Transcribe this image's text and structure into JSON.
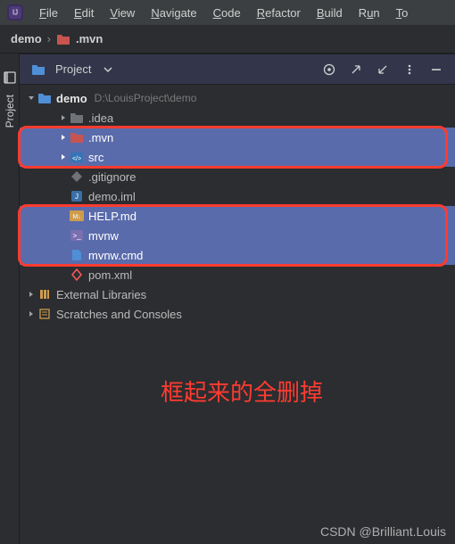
{
  "menubar": {
    "items": [
      {
        "u": "F",
        "rest": "ile"
      },
      {
        "u": "E",
        "rest": "dit"
      },
      {
        "u": "V",
        "rest": "iew"
      },
      {
        "u": "N",
        "rest": "avigate"
      },
      {
        "u": "C",
        "rest": "ode"
      },
      {
        "u": "R",
        "rest": "efactor"
      },
      {
        "u": "B",
        "rest": "uild"
      },
      {
        "u": "R",
        "post": "u",
        "rest": "n"
      },
      {
        "u": "T",
        "rest": "o"
      }
    ]
  },
  "path": {
    "crumb1": "demo",
    "crumb2": ".mvn"
  },
  "rail": {
    "label": "Project"
  },
  "panel": {
    "title": "Project"
  },
  "tree": {
    "root": {
      "name": "demo",
      "hint": "D:\\LouisProject\\demo"
    },
    "items": [
      {
        "name": ".idea",
        "depth": 2,
        "icon": "folder-dark",
        "arrow": "right",
        "selected": false
      },
      {
        "name": ".mvn",
        "depth": 2,
        "icon": "folder-red",
        "arrow": "right",
        "selected": true
      },
      {
        "name": "src",
        "depth": 2,
        "icon": "src-folder",
        "arrow": "right",
        "selected": true
      },
      {
        "name": ".gitignore",
        "depth": 2,
        "icon": "gitignore",
        "arrow": "none",
        "selected": false
      },
      {
        "name": "demo.iml",
        "depth": 2,
        "icon": "iml",
        "arrow": "none",
        "selected": false
      },
      {
        "name": "HELP.md",
        "depth": 2,
        "icon": "md",
        "arrow": "none",
        "selected": true
      },
      {
        "name": "mvnw",
        "depth": 2,
        "icon": "terminal",
        "arrow": "none",
        "selected": true
      },
      {
        "name": "mvnw.cmd",
        "depth": 2,
        "icon": "file-blue",
        "arrow": "none",
        "selected": true
      },
      {
        "name": "pom.xml",
        "depth": 2,
        "icon": "pom",
        "arrow": "none",
        "selected": false
      }
    ],
    "ext1": "External Libraries",
    "ext2": "Scratches and Consoles"
  },
  "annotation": "框起来的全删掉",
  "watermark": "CSDN @Brilliant.Louis",
  "colors": {
    "folder_blue": "#4f8fd6",
    "folder_red": "#c75450",
    "guide_orange": "#ce9c4c",
    "accent_sel": "#5a6bab",
    "highlight": "#ff3b30"
  }
}
